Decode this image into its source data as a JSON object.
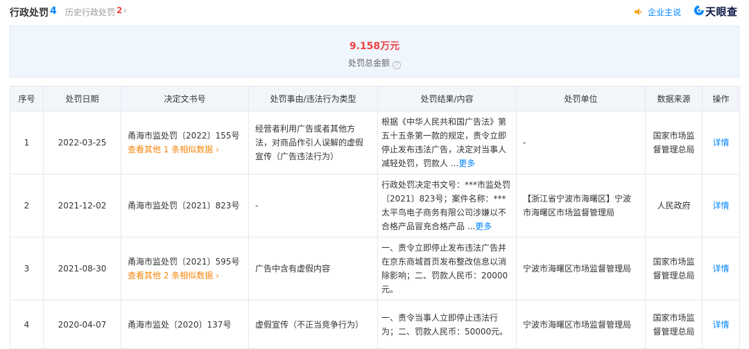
{
  "header": {
    "title": "行政处罚",
    "count": "4",
    "history_label": "历史行政处罚",
    "history_count": "2",
    "history_arrow": "›",
    "claim_label": "企业主说",
    "logo_text": "天眼查"
  },
  "summary": {
    "amount": "9.158万元",
    "label": "处罚总金额",
    "info_glyph": "?"
  },
  "table": {
    "columns": [
      "序号",
      "处罚日期",
      "决定文书号",
      "处罚事由/违法行为类型",
      "处罚结果/内容",
      "处罚单位",
      "数据来源",
      "操作"
    ],
    "rows": [
      {
        "index": "1",
        "date": "2022-03-25",
        "doc_no": "甬海市监处罚〔2022〕155号",
        "similar": "查看其他 1 条相似数据 ›",
        "reason": "经营者利用广告或者其他方法，对商品作引人误解的虚假宣传（广告违法行为）",
        "result": "根据《中华人民共和国广告法》第五十五条第一款的规定，责令立即停止发布违法广告，决定对当事人减轻处罚，罚款人 ...",
        "more": "更多",
        "unit": "-",
        "source": "国家市场监督管理总局",
        "action": "详情"
      },
      {
        "index": "2",
        "date": "2021-12-02",
        "doc_no": "甬海市监处罚〔2021〕823号",
        "similar": "",
        "reason": "-",
        "result": "行政处罚决定书文号：***市监处罚〔2021〕823号；案件名称：***太平鸟电子商务有限公司涉嫌以不合格产品冒充合格产品 ...",
        "more": "更多",
        "unit": "【浙江省宁波市海曙区】宁波市海曙区市场监督管理局",
        "source": "人民政府",
        "action": "详情"
      },
      {
        "index": "3",
        "date": "2021-08-30",
        "doc_no": "甬海市监处罚〔2021〕595号",
        "similar": "查看其他 2 条相似数据 ›",
        "reason": "广告中含有虚假内容",
        "result": "一、责令立即停止发布违法广告并在京东商城首页发布整改信息以消除影响；二、罚款人民币：20000元。",
        "more": "",
        "unit": "宁波市海曙区市场监督管理局",
        "source": "国家市场监督管理总局",
        "action": "详情"
      },
      {
        "index": "4",
        "date": "2020-04-07",
        "doc_no": "甬海市监处〔2020〕137号",
        "similar": "",
        "reason": "虚假宣传（不正当竞争行为）",
        "result": "一、责令当事人立即停止违法行为；二、罚款人民币：50000元。",
        "more": "",
        "unit": "宁波市海曙区市场监督管理局",
        "source": "国家市场监督管理总局",
        "action": "详情"
      }
    ]
  },
  "colors": {
    "accent": "#0084ff",
    "amount": "#f04142",
    "similar_link": "#f5860b",
    "header_bg": "#f2f6fb",
    "summary_bg": "#f0f6fd"
  },
  "icons": [
    "speaker-icon",
    "info-icon",
    "tianyancha-logo-icon",
    "chevron-right-icon"
  ]
}
